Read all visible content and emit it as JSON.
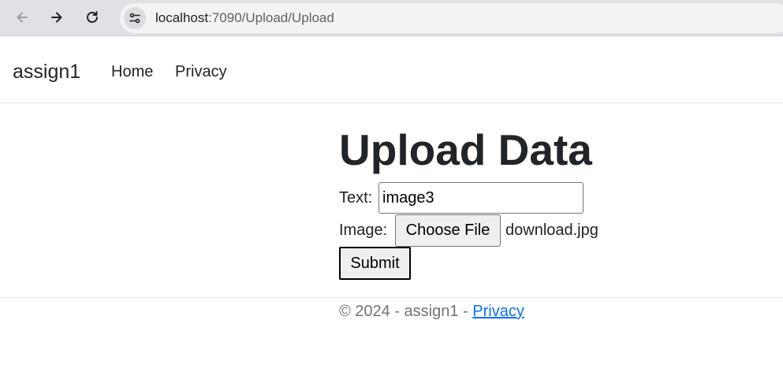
{
  "browser": {
    "url_host": "localhost",
    "url_path": ":7090/Upload/Upload"
  },
  "navbar": {
    "brand": "assign1",
    "links": [
      {
        "label": "Home"
      },
      {
        "label": "Privacy"
      }
    ]
  },
  "main": {
    "title": "Upload Data",
    "text_field": {
      "label": "Text:",
      "value": "image3"
    },
    "image_field": {
      "label": "Image:",
      "button_label": "Choose File",
      "file_name": "download.jpg"
    },
    "submit_label": "Submit"
  },
  "footer": {
    "text": "© 2024 - assign1 - ",
    "link_label": "Privacy"
  },
  "colors": {
    "link": "#0d6efd",
    "footer_text": "#6c757d",
    "chrome_bar": "#dfe1e5"
  }
}
